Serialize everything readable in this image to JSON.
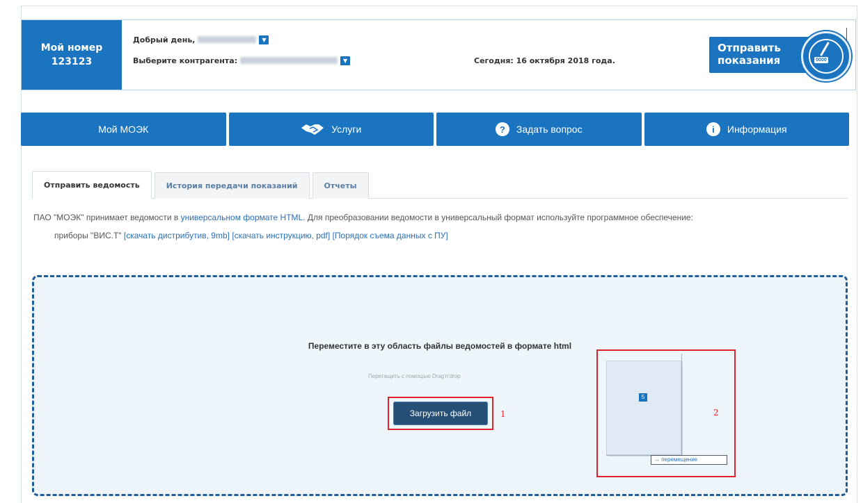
{
  "header": {
    "my_number_label": "Мой номер",
    "my_number_value": "123123",
    "greeting_label": "Добрый день,",
    "contractor_label": "Выберите контрагента:",
    "today_text": "Сегодня: 16 октября 2018 года.",
    "send_button": "Отправить показания",
    "gauge_counter": "0000",
    "dropdown_icon": "chevron-down-icon"
  },
  "nav": {
    "items": [
      {
        "label": "Мой МОЭК",
        "icon": ""
      },
      {
        "label": "Услуги",
        "icon": "handshake-icon"
      },
      {
        "label": "Задать вопрос",
        "icon": "question-icon"
      },
      {
        "label": "Информация",
        "icon": "info-icon"
      }
    ]
  },
  "tabs": [
    {
      "label": "Отправить ведомость",
      "active": true
    },
    {
      "label": "История передачи показаний",
      "active": false
    },
    {
      "label": "Отчеты",
      "active": false
    }
  ],
  "info": {
    "text_before": "ПАО \"МОЭК\" принимает ведомости в ",
    "link_format": "универсальном формате HTML",
    "text_after": ". Для преобразовании ведомости в универсальный формат используйте программное обеспечение:",
    "devices_prefix": "приборы \"ВИС.Т\" ",
    "link_distrib": "[скачать дистрибутив, 9mb]",
    "link_instruction": "[скачать инструкцию, pdf]",
    "link_order": "[Порядок съема данных с ПУ]"
  },
  "dropzone": {
    "title": "Переместите в эту область файлы ведомостей в формате html",
    "subtitle": "Перетащить с помощью Drag'n'drop",
    "upload_button": "Загрузить файл",
    "marker_1": "1",
    "marker_2": "2",
    "drag_count": "5",
    "move_tag": "→ перемещение"
  },
  "colors": {
    "brand_blue": "#1a74bf",
    "upload_dark": "#264f78",
    "highlight_red": "#e0232a",
    "dropzone_bg": "#eef5fb"
  }
}
